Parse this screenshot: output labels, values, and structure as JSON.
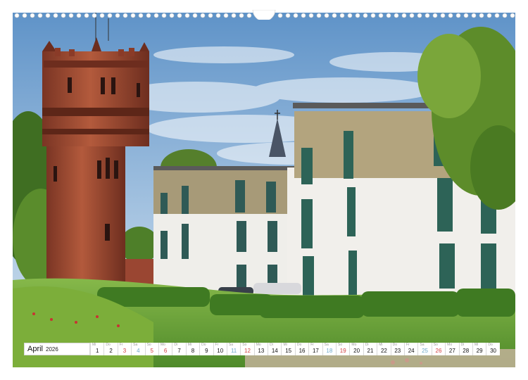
{
  "calendar": {
    "month": "April",
    "year": "2026",
    "days": [
      {
        "n": "1",
        "wd": "Mi",
        "type": "weekday"
      },
      {
        "n": "2",
        "wd": "Do",
        "type": "weekday"
      },
      {
        "n": "3",
        "wd": "Fr",
        "type": "sun"
      },
      {
        "n": "4",
        "wd": "Sa",
        "type": "sat"
      },
      {
        "n": "5",
        "wd": "So",
        "type": "sun"
      },
      {
        "n": "6",
        "wd": "Mo",
        "type": "sun"
      },
      {
        "n": "7",
        "wd": "Di",
        "type": "weekday"
      },
      {
        "n": "8",
        "wd": "Mi",
        "type": "weekday"
      },
      {
        "n": "9",
        "wd": "Do",
        "type": "weekday"
      },
      {
        "n": "10",
        "wd": "Fr",
        "type": "weekday"
      },
      {
        "n": "11",
        "wd": "Sa",
        "type": "sat"
      },
      {
        "n": "12",
        "wd": "So",
        "type": "sun"
      },
      {
        "n": "13",
        "wd": "Mo",
        "type": "weekday"
      },
      {
        "n": "14",
        "wd": "Di",
        "type": "weekday"
      },
      {
        "n": "15",
        "wd": "Mi",
        "type": "weekday"
      },
      {
        "n": "16",
        "wd": "Do",
        "type": "weekday"
      },
      {
        "n": "17",
        "wd": "Fr",
        "type": "weekday"
      },
      {
        "n": "18",
        "wd": "Sa",
        "type": "sat"
      },
      {
        "n": "19",
        "wd": "So",
        "type": "sun"
      },
      {
        "n": "20",
        "wd": "Mo",
        "type": "weekday"
      },
      {
        "n": "21",
        "wd": "Di",
        "type": "weekday"
      },
      {
        "n": "22",
        "wd": "Mi",
        "type": "weekday"
      },
      {
        "n": "23",
        "wd": "Do",
        "type": "weekday"
      },
      {
        "n": "24",
        "wd": "Fr",
        "type": "weekday"
      },
      {
        "n": "25",
        "wd": "Sa",
        "type": "sat"
      },
      {
        "n": "26",
        "wd": "So",
        "type": "sun"
      },
      {
        "n": "27",
        "wd": "Mo",
        "type": "weekday"
      },
      {
        "n": "28",
        "wd": "Di",
        "type": "weekday"
      },
      {
        "n": "29",
        "wd": "Mi",
        "type": "weekday"
      },
      {
        "n": "30",
        "wd": "Do",
        "type": "weekday"
      }
    ]
  },
  "colors": {
    "sunday": "#d34040",
    "saturday": "#6da8c9",
    "sky": "#6f9fd0",
    "brick": "#a4503a",
    "lawn": "#6fa43a"
  }
}
